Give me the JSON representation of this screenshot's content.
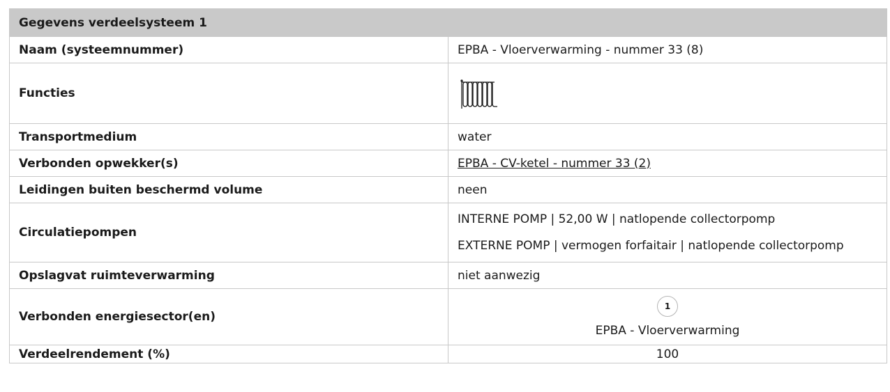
{
  "header": {
    "title": "Gegevens verdeelsysteem 1"
  },
  "rows": {
    "naam": {
      "label": "Naam (systeemnummer)",
      "value": "EPBA - Vloerverwarming - nummer 33 (8)"
    },
    "functies": {
      "label": "Functies",
      "icon": "radiator-icon"
    },
    "transportmedium": {
      "label": "Transportmedium",
      "value": "water"
    },
    "opwekkers": {
      "label": "Verbonden opwekker(s)",
      "value": "EPBA - CV-ketel - nummer 33 (2)"
    },
    "leidingen": {
      "label": "Leidingen buiten beschermd volume",
      "value": "neen"
    },
    "pompen": {
      "label": "Circulatiepompen",
      "values": [
        "INTERNE POMP | 52,00 W | natlopende collectorpomp",
        "EXTERNE POMP | vermogen forfaitair | natlopende collectorpomp"
      ]
    },
    "opslagvat": {
      "label": "Opslagvat ruimteverwarming",
      "value": "niet aanwezig"
    },
    "energiesector": {
      "label": "Verbonden energiesector(en)",
      "badge": "1",
      "value": "EPBA - Vloerverwarming"
    },
    "rendement": {
      "label": "Verdeelrendement (%)",
      "value": "100"
    }
  },
  "colors": {
    "header_bg": "#c9c9c9",
    "border": "#c8c8c8"
  }
}
